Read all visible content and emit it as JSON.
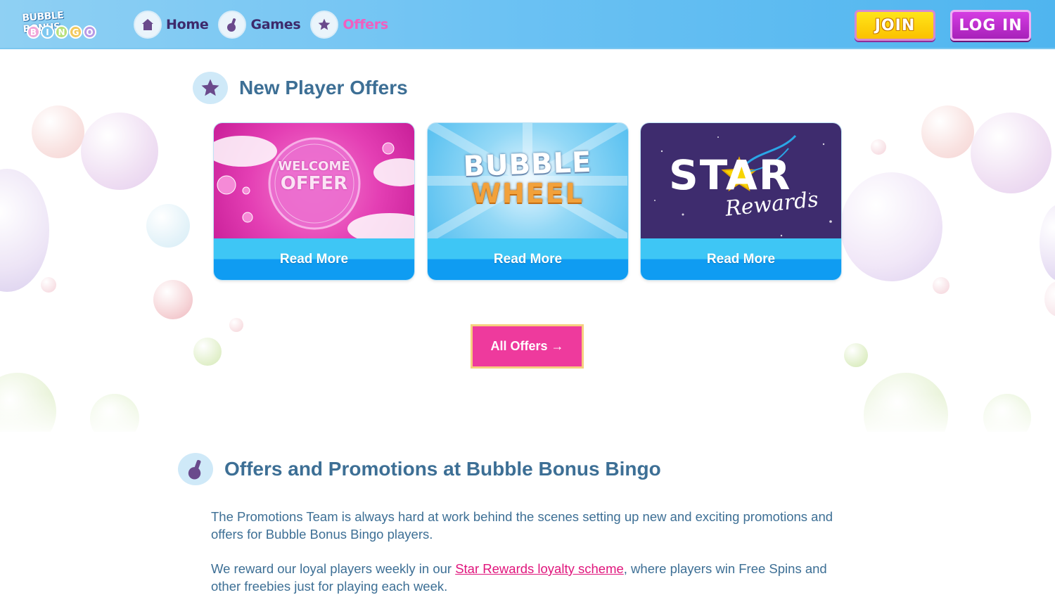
{
  "header": {
    "logo": {
      "top_text": "BUBBLE BONUS",
      "bottom_letters": [
        "B",
        "I",
        "N",
        "G",
        "O"
      ]
    },
    "nav": [
      {
        "label": "Home",
        "icon": "house-icon",
        "active": false
      },
      {
        "label": "Games",
        "icon": "bingo-dabber-icon",
        "active": false
      },
      {
        "label": "Offers",
        "icon": "star-icon",
        "active": true
      }
    ],
    "join_label": "JOIN",
    "login_label": "LOG IN"
  },
  "new_player_offers": {
    "title": "New Player Offers",
    "cards": [
      {
        "image_text_line1": "WELCOME",
        "image_text_line2": "OFFER",
        "button_label": "Read More"
      },
      {
        "image_text_line1": "BUBBLE",
        "image_text_line2": "WHEEL",
        "button_label": "Read More"
      },
      {
        "image_text_line1": "STAR",
        "image_text_line2": "Rewards",
        "button_label": "Read More"
      }
    ],
    "all_offers_label": "All Offers →"
  },
  "promotions": {
    "title": "Offers and Promotions at Bubble Bonus Bingo",
    "paragraph1": "The Promotions Team is always hard at work behind the scenes setting up new and exciting promotions and offers for Bubble Bonus Bingo players.",
    "paragraph2_before": "We reward our loyal players weekly in our ",
    "paragraph2_link": "Star Rewards loyalty scheme",
    "paragraph2_after": ", where players win Free Spins and other freebies just for playing each week."
  },
  "colors": {
    "header_blue": "#6ac1f3",
    "nav_text": "#3d2a6b",
    "nav_active": "#f05fc0",
    "join_yellow": "#ffd60a",
    "login_purple": "#c02fd0",
    "title_blue": "#3d6f95",
    "card_button_blue": "#0f9cf2",
    "all_offers_pink": "#ee3a9d",
    "link_pink": "#e0157c"
  }
}
